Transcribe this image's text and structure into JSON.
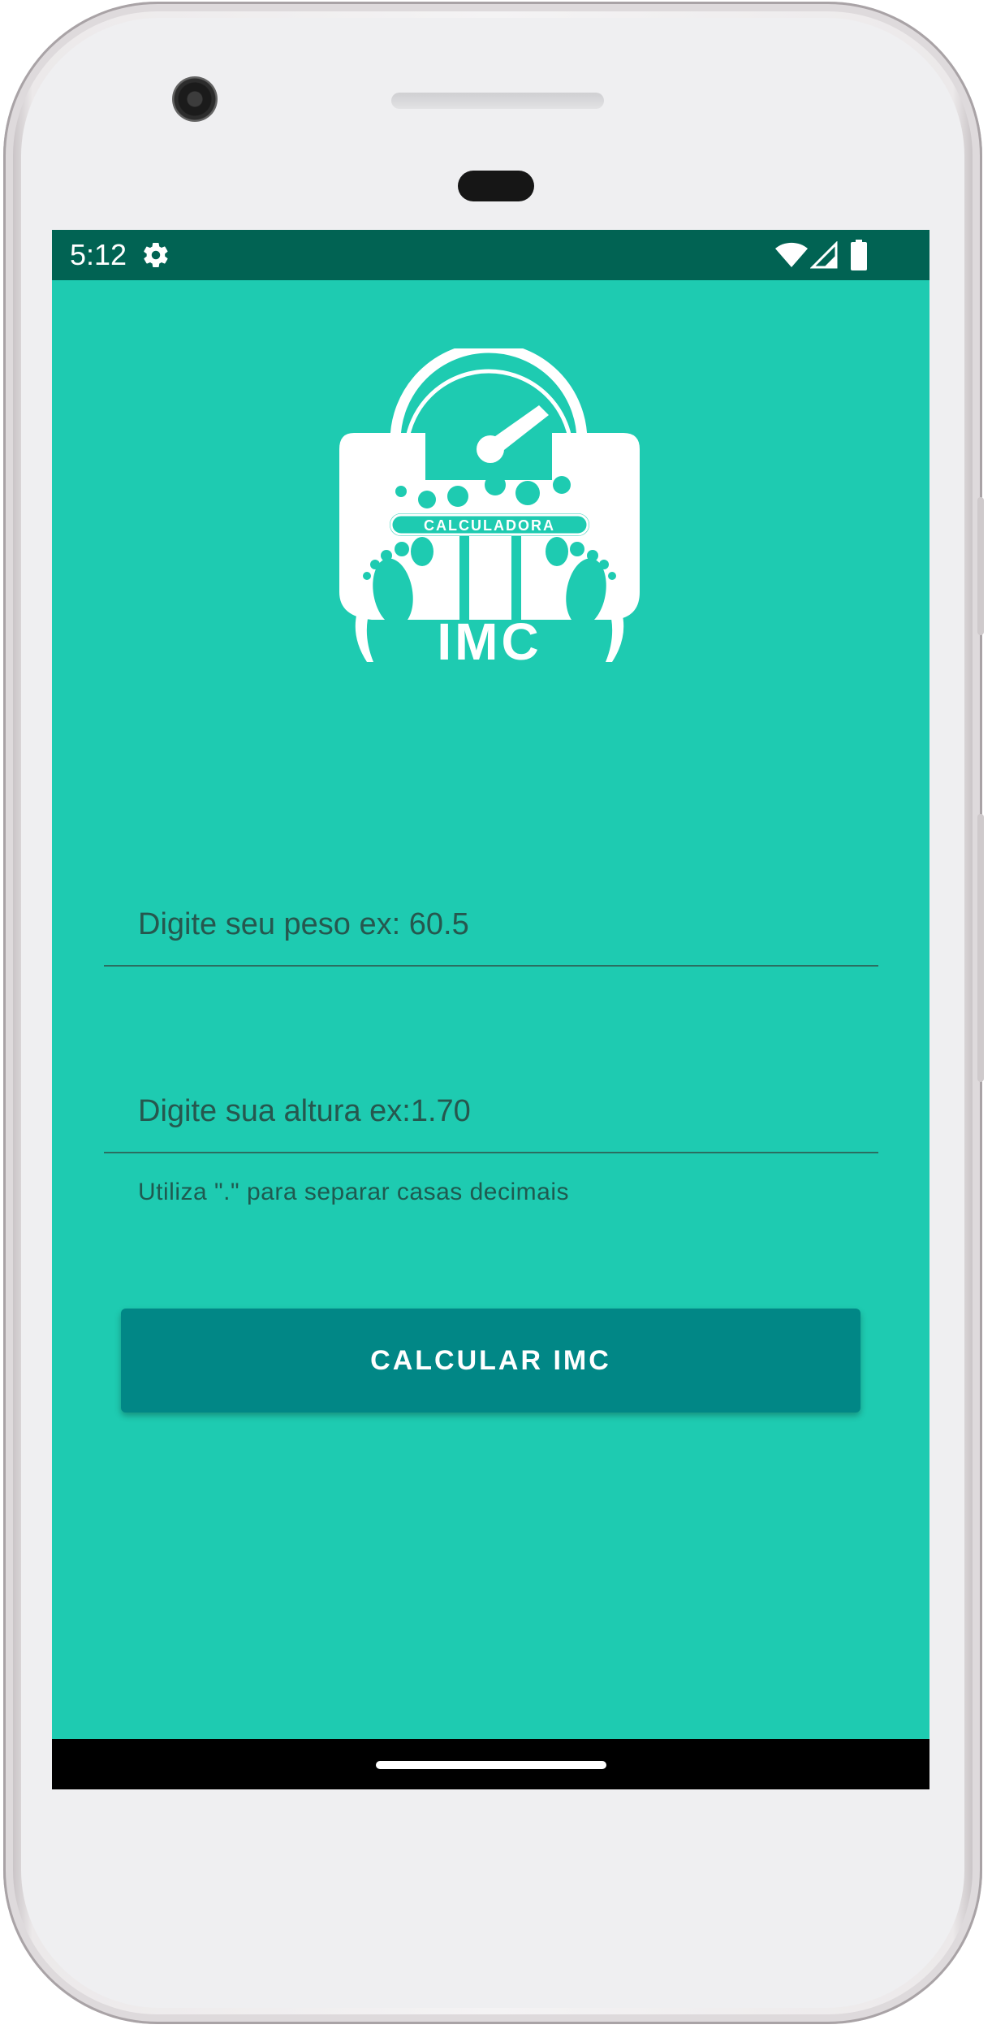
{
  "status_bar": {
    "time": "5:12",
    "icons": [
      "gear-icon",
      "wifi-icon",
      "signal-icon",
      "battery-icon"
    ]
  },
  "logo": {
    "subtitle": "CALCULADORA",
    "title": "IMC"
  },
  "form": {
    "weight": {
      "placeholder": "Digite seu peso ex: 60.5",
      "value": ""
    },
    "height": {
      "placeholder": "Digite sua altura ex:1.70",
      "value": ""
    },
    "helper_text": "Utiliza \".\" para separar casas decimais"
  },
  "button": {
    "label": "CALCULAR IMC"
  },
  "colors": {
    "background": "#1ecbb1",
    "status_bar": "#016353",
    "button": "#018786",
    "text": "#26574e"
  }
}
